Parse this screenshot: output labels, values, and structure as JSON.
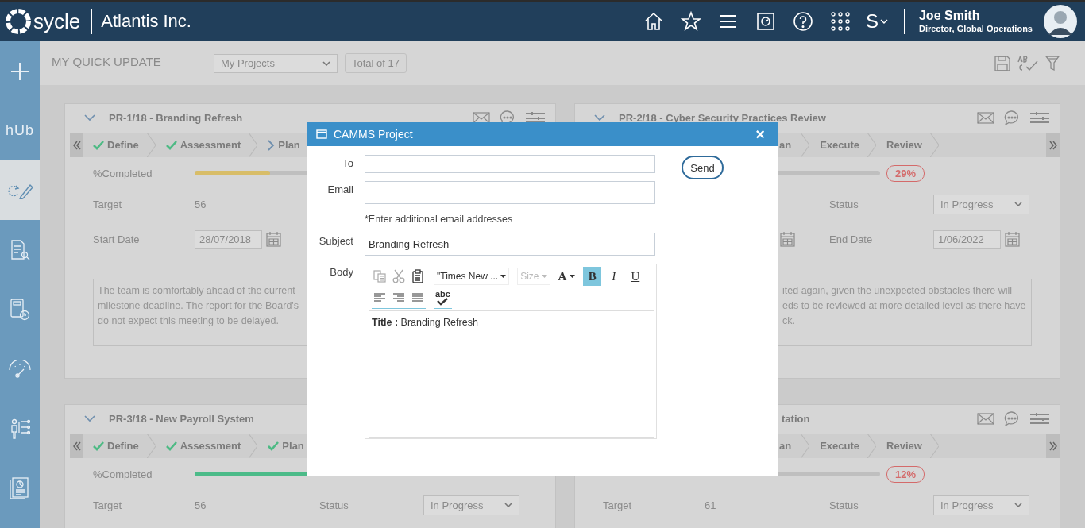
{
  "header": {
    "product": "sycle",
    "company": "Atlantis Inc.",
    "switcher": "S",
    "user": {
      "name": "Joe Smith",
      "role": "Director, Global Operations"
    }
  },
  "sidebar": {
    "items": [
      {
        "kind": "add",
        "selected": false
      },
      {
        "kind": "hub",
        "label": "hUb",
        "selected": false
      },
      {
        "kind": "update",
        "selected": true
      },
      {
        "kind": "review",
        "selected": false
      },
      {
        "kind": "calculator",
        "selected": false
      },
      {
        "kind": "gauge",
        "selected": false
      },
      {
        "kind": "org",
        "selected": false
      },
      {
        "kind": "report",
        "selected": false
      }
    ]
  },
  "toolbar": {
    "title": "MY QUICK UPDATE",
    "view": "My Projects",
    "total": "Total of 17"
  },
  "cards": [
    {
      "title": "PR-1/18 - Branding Refresh",
      "title_clipped": false,
      "header_icons": true,
      "scroll_left": true,
      "scroll_right": false,
      "stages": [
        {
          "label": "Define",
          "kind": "done",
          "clipped": false
        },
        {
          "label": "Assessment",
          "kind": "done",
          "clipped": false
        },
        {
          "label": "Plan",
          "kind": "current",
          "clipped": false
        }
      ],
      "progress": {
        "label": "%Completed",
        "level": 0.43,
        "color": "#d8bd68"
      },
      "rows": [
        {
          "cells": [
            {
              "kind": "label",
              "text": "Target"
            },
            {
              "kind": "value",
              "text": "56"
            }
          ]
        },
        {
          "cells": [
            {
              "kind": "label",
              "text": "Start Date"
            },
            {
              "kind": "date",
              "text": "28/07/2018"
            }
          ]
        }
      ],
      "note": {
        "clipped": false,
        "lines": [
          "The team is comfortably ahead of the current",
          "milestone deadline. The report for the Board's",
          "do not expect this meeting to be delayed."
        ]
      }
    },
    {
      "title": "PR-2/18 - Cyber Security Practices Review",
      "title_clipped": false,
      "header_icons": true,
      "scroll_left": false,
      "scroll_right": true,
      "stages": [
        {
          "label": "an",
          "kind": "todo",
          "clipped": true
        },
        {
          "label": "Execute",
          "kind": "todo",
          "clipped": false
        },
        {
          "label": "Review",
          "kind": "todo",
          "clipped": false
        }
      ],
      "progress": {
        "badge": "29%",
        "color": "#d46a6a"
      },
      "rows": [
        {
          "cells": [
            {
              "kind": "empty"
            },
            {
              "kind": "empty"
            },
            {
              "kind": "label",
              "text": "Status"
            },
            {
              "kind": "select",
              "text": "In Progress"
            }
          ]
        },
        {
          "cells": [
            {
              "kind": "empty"
            },
            {
              "kind": "date"
            },
            {
              "kind": "label",
              "text": "End Date"
            },
            {
              "kind": "date",
              "text": "1/06/2022"
            }
          ]
        }
      ],
      "note": {
        "clipped": true,
        "lines": [
          "ited again, given the unexpected obstacles there will",
          "eds to be reviewed at more detailed level as there have",
          "ck."
        ]
      }
    },
    {
      "title": "PR-3/18 - New Payroll System",
      "title_clipped": false,
      "header_icons": false,
      "scroll_left": true,
      "scroll_right": false,
      "stages": [
        {
          "label": "Define",
          "kind": "done",
          "clipped": false
        },
        {
          "label": "Assessment",
          "kind": "done",
          "clipped": false
        },
        {
          "label": "Plan",
          "kind": "done",
          "clipped": false
        }
      ],
      "progress": {
        "label": "%Completed",
        "level": 0.77,
        "color": "#4cbb89"
      },
      "rows": [
        {
          "cells": [
            {
              "kind": "label",
              "text": "Target"
            },
            {
              "kind": "value",
              "text": "56"
            },
            {
              "kind": "label",
              "text": "Status"
            },
            {
              "kind": "select",
              "text": "In Progress"
            }
          ]
        }
      ]
    },
    {
      "title": "tation",
      "title_clipped": true,
      "header_icons": true,
      "scroll_left": false,
      "scroll_right": true,
      "stages": [
        {
          "label": "an",
          "kind": "todo",
          "clipped": true
        },
        {
          "label": "Execute",
          "kind": "todo",
          "clipped": false
        },
        {
          "label": "Review",
          "kind": "todo",
          "clipped": false
        }
      ],
      "progress": {
        "badge": "12%",
        "color": "#d46a6a"
      },
      "rows": [
        {
          "cells": [
            {
              "kind": "label",
              "text": "Target"
            },
            {
              "kind": "value",
              "text": "61"
            },
            {
              "kind": "label",
              "text": "Status"
            },
            {
              "kind": "select",
              "text": "In Progress"
            }
          ]
        }
      ]
    }
  ],
  "dialog": {
    "title": "CAMMS Project",
    "close": "×",
    "send": "Send",
    "fields": [
      {
        "label": "To"
      },
      {
        "label": "Email",
        "hint": "*Enter additional email addresses"
      },
      {
        "label": "Subject",
        "value": "Branding Refresh"
      }
    ],
    "body_label": "Body",
    "editor": {
      "toolbar": [
        [
          {
            "items": [
              {
                "kind": "copy",
                "disabled": true
              },
              {
                "kind": "cut",
                "disabled": true
              },
              {
                "kind": "paste",
                "disabled": false
              }
            ]
          },
          {
            "items": [
              {
                "kind": "select",
                "label": "\"Times New ...",
                "disabled": false
              }
            ]
          },
          {
            "items": [
              {
                "kind": "select",
                "label": "Size",
                "disabled": true
              }
            ]
          },
          {
            "items": [
              {
                "kind": "color",
                "label": "A",
                "disabled": false
              }
            ]
          },
          {
            "items": [
              {
                "kind": "bold",
                "label": "B",
                "selected": true
              },
              {
                "kind": "italic",
                "label": "I",
                "selected": false
              },
              {
                "kind": "underline",
                "label": "U",
                "selected": false
              }
            ]
          }
        ],
        [
          {
            "items": [
              {
                "kind": "align-left",
                "disabled": false
              },
              {
                "kind": "align-right",
                "disabled": false
              },
              {
                "kind": "justify",
                "disabled": false
              }
            ]
          },
          {
            "items": [
              {
                "kind": "spellcheck",
                "label": "abc",
                "disabled": false
              }
            ]
          }
        ]
      ],
      "content": "**Title :** Branding Refresh"
    }
  }
}
